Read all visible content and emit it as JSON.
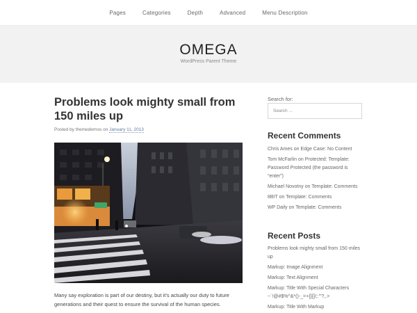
{
  "nav": {
    "items": [
      {
        "label": "Pages"
      },
      {
        "label": "Categories"
      },
      {
        "label": "Depth"
      },
      {
        "label": "Advanced"
      },
      {
        "label": "Menu Description"
      }
    ]
  },
  "header": {
    "title": "OMEGA",
    "description": "WordPress Parent Theme"
  },
  "post": {
    "title": "Problems look mighty small from 150 miles up",
    "byline_prefix": "Posted by",
    "author": "themedemos",
    "byline_on": "on",
    "date": "January 11, 2013",
    "excerpt": "Many say exploration is part of our destiny, but it’s actually our duty to future generations and their quest to ensure the survival of the human species."
  },
  "sidebar": {
    "search_label": "Search for:",
    "search_placeholder": "Search ...",
    "recent_comments_title": "Recent Comments",
    "recent_comments": [
      {
        "author": "Chris Ames",
        "on": "on",
        "post": "Edge Case: No Content"
      },
      {
        "author": "Tom McFarlin",
        "on": "on",
        "post": "Protected: Template: Password Protected (the password is “enter”)"
      },
      {
        "author": "Michael Novotny",
        "on": "on",
        "post": "Template: Comments"
      },
      {
        "author": "8BIT",
        "on": "on",
        "post": "Template: Comments"
      },
      {
        "author": "WP Daily",
        "on": "on",
        "post": "Template: Comments"
      }
    ],
    "recent_posts_title": "Recent Posts",
    "recent_posts": [
      {
        "label": "Problems look mighty small from 150 miles up"
      },
      {
        "label": "Markup: Image Alignment"
      },
      {
        "label": "Markup: Text Alignment"
      },
      {
        "label": "Markup: Title With Special Characters ~`!@#$%^&*()-_=+{}[]/;:'\"?,.>"
      },
      {
        "label": "Markup: Title With Markup"
      }
    ]
  }
}
